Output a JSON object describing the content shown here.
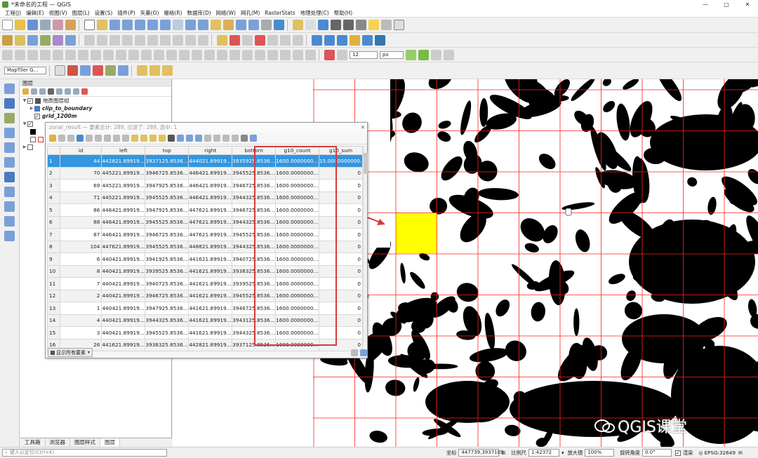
{
  "window": {
    "title": "*未命名的工程 — QGIS",
    "buttons": [
      "—",
      "▢",
      "✕"
    ]
  },
  "menu": [
    "工程(J)",
    "编辑(E)",
    "视图(V)",
    "图层(L)",
    "设置(S)",
    "插件(P)",
    "矢量(O)",
    "栅格(R)",
    "数据库(D)",
    "网络(W)",
    "网孔(M)",
    "RasterStats",
    "地理处理(C)",
    "帮助(H)"
  ],
  "toolbar3": {
    "font_size": "12",
    "font_unit": "px"
  },
  "locator_combo": "MapTiler G…",
  "layers_panel": {
    "title": "图层",
    "items": [
      {
        "name": "地质图层组",
        "level": 0,
        "checked": true,
        "style": "group"
      },
      {
        "name": "clip_to_boundary",
        "level": 1,
        "checked": false,
        "style": "layer"
      },
      {
        "name": "grid_1200m",
        "level": 1,
        "checked": true,
        "style": "layer"
      }
    ]
  },
  "bottom_tabs": [
    "工具箱",
    "浏览器",
    "图层样式",
    "图层"
  ],
  "attribute_table": {
    "title": "zonal_result — 要素总计: 289, 过滤了: 289, 选中: 1",
    "columns": [
      "id",
      "left",
      "top",
      "right",
      "bottom",
      "g10_count",
      "g10_sum"
    ],
    "rows": [
      [
        "1",
        "44",
        "442821.89919...",
        "3937125.8536...",
        "444021.89919...",
        "3935925.8536...",
        "1600.0000000...",
        "15.0000000000..."
      ],
      [
        "2",
        "70",
        "445221.89919...",
        "3946725.8536...",
        "446421.89919...",
        "3945525.8536...",
        "1600.0000000...",
        "0"
      ],
      [
        "3",
        "69",
        "445221.89919...",
        "3947925.8536...",
        "446421.89919...",
        "3946725.8536...",
        "1600.0000000...",
        "0"
      ],
      [
        "4",
        "71",
        "445221.89919...",
        "3945525.8536...",
        "446421.89919...",
        "3944325.8536...",
        "1600.0000000...",
        "0"
      ],
      [
        "5",
        "86",
        "446421.89919...",
        "3947925.8536...",
        "447621.89919...",
        "3946725.8536...",
        "1600.0000000...",
        "0"
      ],
      [
        "6",
        "88",
        "446421.89919...",
        "3945525.8536...",
        "447621.89919...",
        "3944325.8536...",
        "1600.0000000...",
        "0"
      ],
      [
        "7",
        "87",
        "446421.89919...",
        "3946725.8536...",
        "447621.89919...",
        "3945525.8536...",
        "1600.0000000...",
        "0"
      ],
      [
        "8",
        "104",
        "447621.89919...",
        "3945525.8536...",
        "448821.89919...",
        "3944325.8536...",
        "1600.0000000...",
        "0"
      ],
      [
        "9",
        "6",
        "440421.89919...",
        "3941925.8536...",
        "441621.89919...",
        "3940725.8536...",
        "1600.0000000...",
        "0"
      ],
      [
        "10",
        "8",
        "440421.89919...",
        "3939525.8536...",
        "441621.89919...",
        "3938325.8536...",
        "1600.0000000...",
        "0"
      ],
      [
        "11",
        "7",
        "440421.89919...",
        "3940725.8536...",
        "441621.89919...",
        "3939525.8536...",
        "1600.0000000...",
        "0"
      ],
      [
        "12",
        "2",
        "440421.89919...",
        "3946725.8536...",
        "441621.89919...",
        "3945525.8536...",
        "1600.0000000...",
        "0"
      ],
      [
        "13",
        "1",
        "440421.89919...",
        "3947925.8536...",
        "441621.89919...",
        "3946725.8536...",
        "1600.0000000...",
        "0"
      ],
      [
        "14",
        "4",
        "440421.89919...",
        "3944325.8536...",
        "441621.89919...",
        "3943125.8536...",
        "1600.0000000...",
        "0"
      ],
      [
        "15",
        "3",
        "440421.89919...",
        "3945525.8536...",
        "441621.89919...",
        "3944325.8536...",
        "1600.0000000...",
        "0"
      ],
      [
        "16",
        "26",
        "441621.89919...",
        "3938325.8536...",
        "442821.89919...",
        "3937125.8536...",
        "1600.0000000...",
        "0"
      ]
    ],
    "selected_row": 0,
    "show_all_button": "显示所有要素"
  },
  "watermark": "QGIS课堂",
  "statusbar": {
    "search_placeholder": "键入以定位(Ctrl+K)",
    "coord_label": "坐标",
    "coord_value": "447739,3937105",
    "scale_label": "比例尺",
    "scale_value": "1:42372",
    "magnifier_label": "放大镜",
    "magnifier_value": "100%",
    "rotation_label": "旋转角度",
    "rotation_value": "0.0°",
    "render_label": "渲染",
    "crs": "EPSG:32649"
  },
  "colors": {
    "selection": "#3296e0",
    "highlight_cell": "#ffff00",
    "grid_line": "#ff2020",
    "annotation": "#d63a3a",
    "qgis_green": "#589632"
  }
}
